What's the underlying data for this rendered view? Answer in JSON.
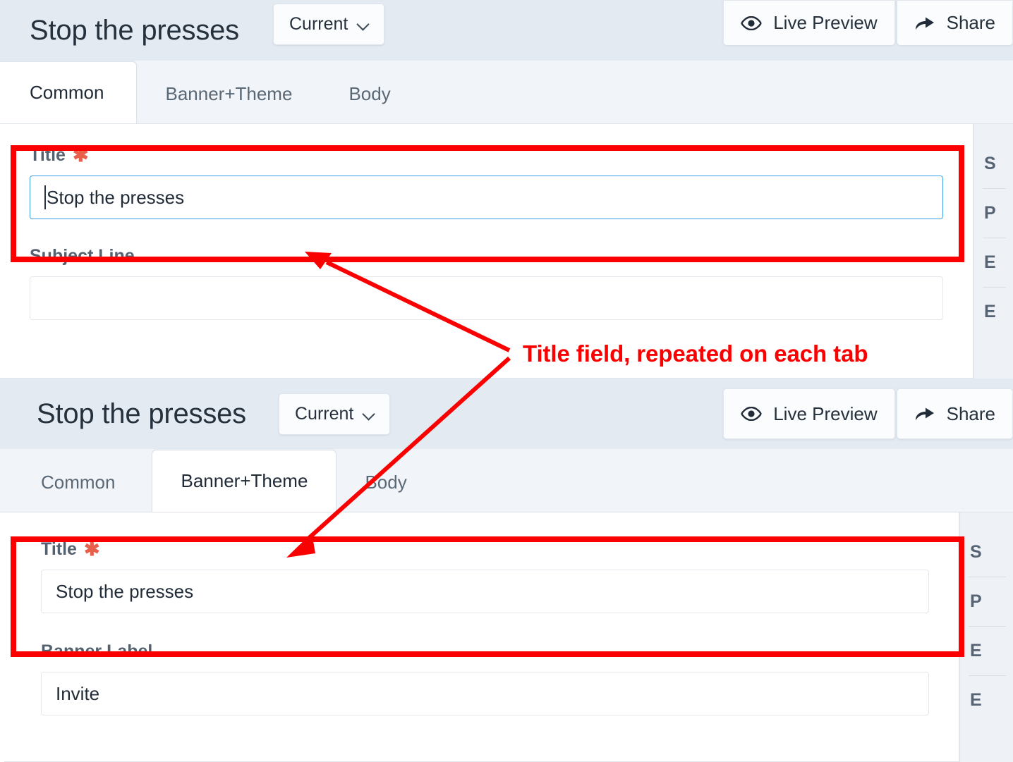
{
  "panels": [
    {
      "id": "panel-common",
      "header": {
        "title": "Stop the presses",
        "version_label": "Current",
        "actions": [
          {
            "label": "Live Preview",
            "icon": "eye-icon"
          },
          {
            "label": "Share",
            "icon": "share-arrow-icon"
          }
        ]
      },
      "tabs": [
        {
          "label": "Common",
          "active": true
        },
        {
          "label": "Banner+Theme",
          "active": false
        },
        {
          "label": "Body",
          "active": false
        }
      ],
      "fields": [
        {
          "label": "Title",
          "required": true,
          "value": "Stop the presses",
          "focused": true,
          "placeholder": ""
        },
        {
          "label": "Subject Line",
          "required": false,
          "value": "",
          "focused": false,
          "placeholder": ""
        }
      ],
      "right_rail": [
        "S",
        "P",
        "E",
        "E"
      ]
    },
    {
      "id": "panel-banner-theme",
      "header": {
        "title": "Stop the presses",
        "version_label": "Current",
        "actions": [
          {
            "label": "Live Preview",
            "icon": "eye-icon"
          },
          {
            "label": "Share",
            "icon": "share-arrow-icon"
          }
        ]
      },
      "tabs": [
        {
          "label": "Common",
          "active": false
        },
        {
          "label": "Banner+Theme",
          "active": true
        },
        {
          "label": "Body",
          "active": false
        }
      ],
      "fields": [
        {
          "label": "Title",
          "required": true,
          "value": "Stop the presses",
          "focused": false,
          "placeholder": ""
        },
        {
          "label": "Banner Label",
          "required": false,
          "value": "Invite",
          "focused": false,
          "placeholder": ""
        }
      ],
      "right_rail": [
        "S",
        "P",
        "E",
        "E"
      ]
    }
  ],
  "annotation": {
    "text": "Title field, repeated on each tab",
    "color": "#fb0000"
  }
}
